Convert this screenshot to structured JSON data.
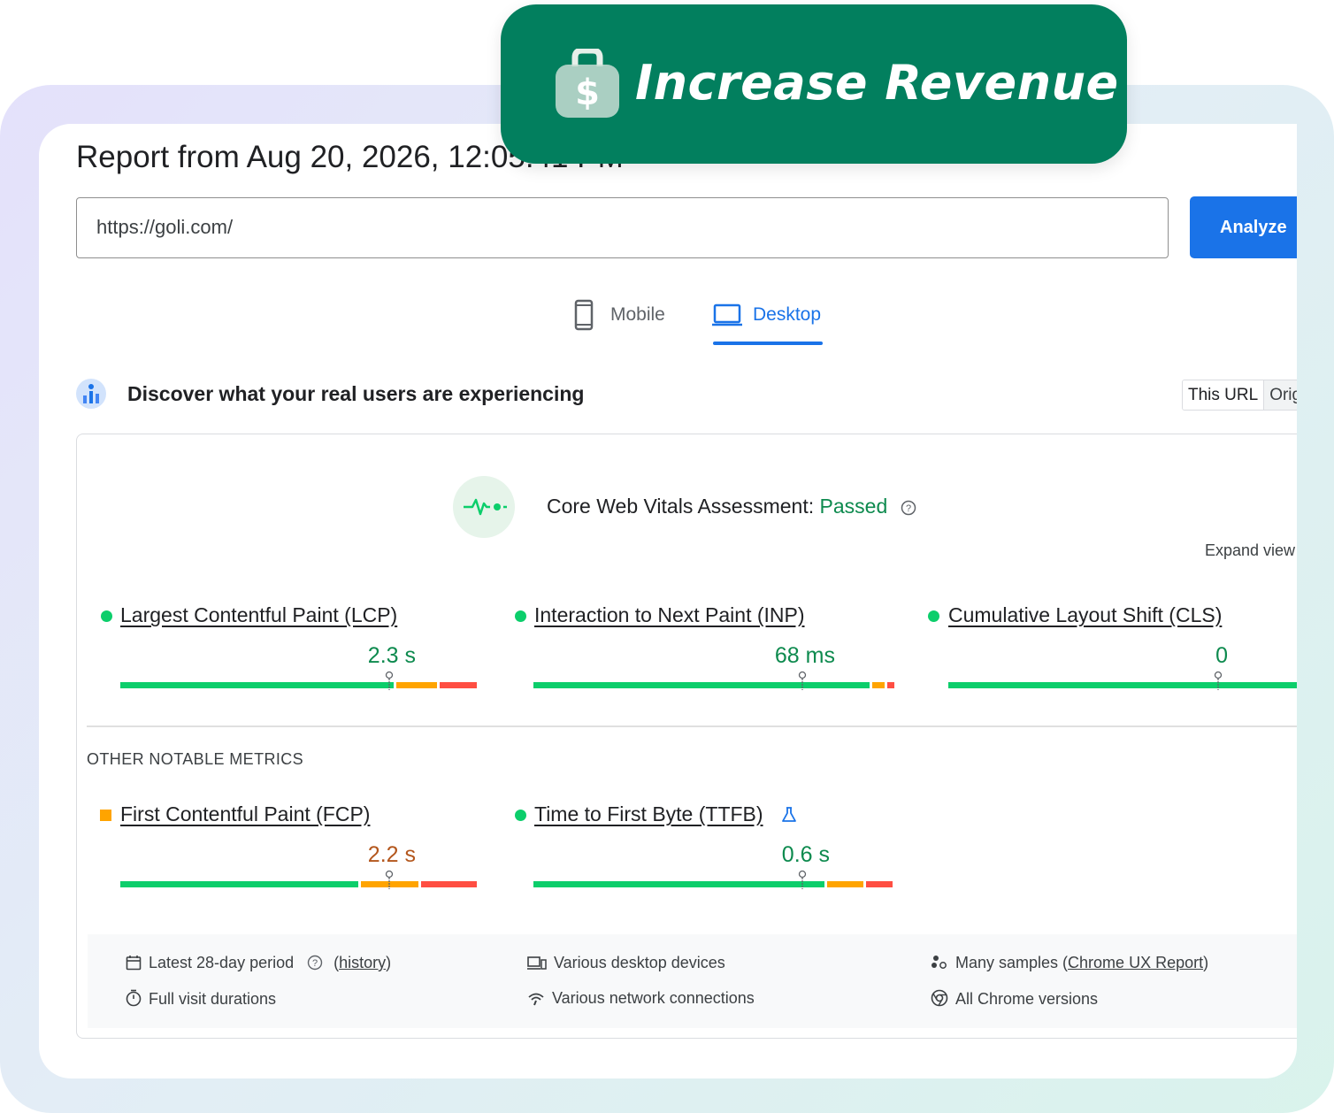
{
  "badge": {
    "label": "Increase Revenue",
    "icon": "dollar-bag-icon"
  },
  "report": {
    "title": "Report from Aug 20, 2026, 12:05:41 PM",
    "url": "https://goli.com/",
    "analyze_label": "Analyze"
  },
  "tabs": [
    {
      "label": "Mobile",
      "icon": "phone-icon",
      "active": false
    },
    {
      "label": "Desktop",
      "icon": "laptop-icon",
      "active": true
    }
  ],
  "discover": {
    "text": "Discover what your real users are experiencing",
    "toggle": [
      "This URL",
      "Origin"
    ]
  },
  "cwv": {
    "label": "Core Web Vitals Assessment: ",
    "status": "Passed",
    "expand_label": "Expand view"
  },
  "metrics": [
    {
      "name": "Largest Contentful Paint (LCP)",
      "value": "2.3 s",
      "rating": "good"
    },
    {
      "name": "Interaction to Next Paint (INP)",
      "value": "68 ms",
      "rating": "good"
    },
    {
      "name": "Cumulative Layout Shift (CLS)",
      "value": "0",
      "rating": "good"
    }
  ],
  "other_label": "OTHER NOTABLE METRICS",
  "other_metrics": [
    {
      "name": "First Contentful Paint (FCP)",
      "value": "2.2 s",
      "rating": "needs-improvement"
    },
    {
      "name": "Time to First Byte (TTFB)",
      "value": "0.6 s",
      "rating": "good",
      "experimental": true
    }
  ],
  "footer": {
    "period": "Latest 28-day period",
    "history": "history",
    "devices": "Various desktop devices",
    "samples_prefix": "Many samples (",
    "samples_link": "Chrome UX Report",
    "samples_suffix": ")",
    "durations": "Full visit durations",
    "network": "Various network connections",
    "versions": "All Chrome versions"
  },
  "colors": {
    "brand_green": "#027f5e",
    "good": "#0cce6b",
    "needs_improvement": "#ffa400",
    "poor": "#ff4e42",
    "accent_blue": "#1a73e8"
  }
}
